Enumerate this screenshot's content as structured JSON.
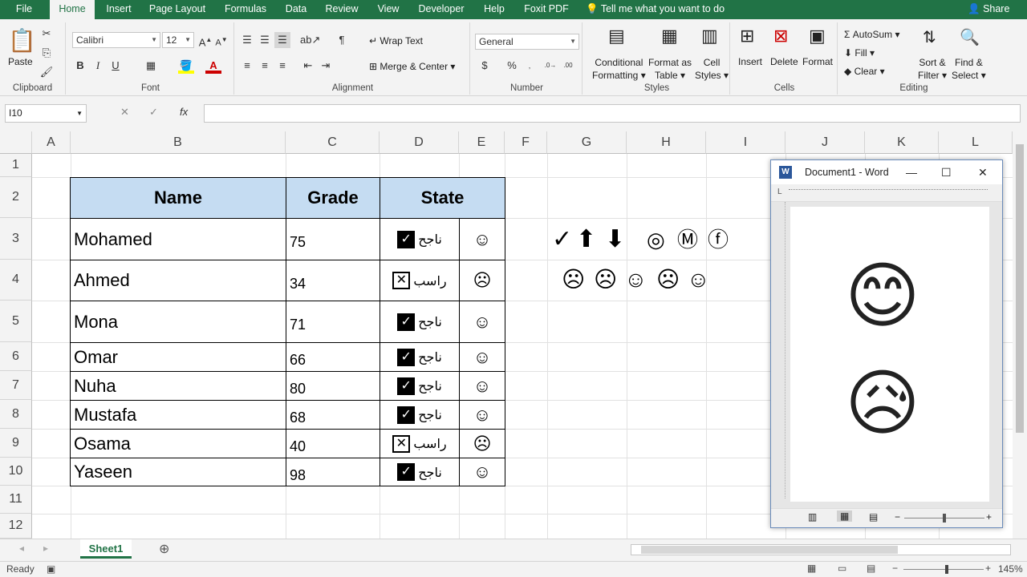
{
  "tabs": [
    "File",
    "Home",
    "Insert",
    "Page Layout",
    "Formulas",
    "Data",
    "Review",
    "View",
    "Developer",
    "Help",
    "Foxit PDF"
  ],
  "tellme": "Tell me what you want to do",
  "share": "Share",
  "ribbon": {
    "clipboard": {
      "label": "Clipboard",
      "paste": "Paste"
    },
    "font": {
      "label": "Font",
      "family": "Calibri",
      "size": "12"
    },
    "alignment": {
      "label": "Alignment",
      "wrap": "Wrap Text",
      "merge": "Merge & Center"
    },
    "number": {
      "label": "Number",
      "format": "General"
    },
    "styles": {
      "label": "Styles",
      "cond1": "Conditional",
      "cond2": "Formatting",
      "fmt1": "Format as",
      "fmt2": "Table",
      "cell1": "Cell",
      "cell2": "Styles"
    },
    "cells": {
      "label": "Cells",
      "insert": "Insert",
      "delete": "Delete",
      "format": "Format"
    },
    "editing": {
      "label": "Editing",
      "autosum": "AutoSum",
      "fill": "Fill",
      "clear": "Clear",
      "sort1": "Sort &",
      "sort2": "Filter",
      "find1": "Find &",
      "find2": "Select"
    }
  },
  "namebox": "I10",
  "columns": [
    "A",
    "B",
    "C",
    "D",
    "E",
    "F",
    "G",
    "H",
    "I",
    "J",
    "K",
    "L"
  ],
  "rows": [
    "1",
    "2",
    "3",
    "4",
    "5",
    "6",
    "7",
    "8",
    "9",
    "10",
    "11",
    "12"
  ],
  "table": {
    "headers": {
      "name": "Name",
      "grade": "Grade",
      "state": "State"
    },
    "records": [
      {
        "name": "Mohamed",
        "grade": "75",
        "state": "ناجح",
        "pass": true
      },
      {
        "name": "Ahmed",
        "grade": "34",
        "state": "راسب",
        "pass": false
      },
      {
        "name": "Mona",
        "grade": "71",
        "state": "ناجح",
        "pass": true
      },
      {
        "name": "Omar",
        "grade": "66",
        "state": "ناجح",
        "pass": true
      },
      {
        "name": "Nuha",
        "grade": "80",
        "state": "ناجح",
        "pass": true
      },
      {
        "name": "Mustafa",
        "grade": "68",
        "state": "ناجح",
        "pass": true
      },
      {
        "name": "Osama",
        "grade": "40",
        "state": "راسب",
        "pass": false
      },
      {
        "name": "Yaseen",
        "grade": "98",
        "state": "ناجح",
        "pass": true
      }
    ]
  },
  "sheet": "Sheet1",
  "status": {
    "ready": "Ready",
    "zoom": "145%"
  },
  "word": {
    "title": "Document1 - Word"
  },
  "colors": {
    "excel_green": "#217346",
    "header_fill": "#c5dcf2"
  }
}
